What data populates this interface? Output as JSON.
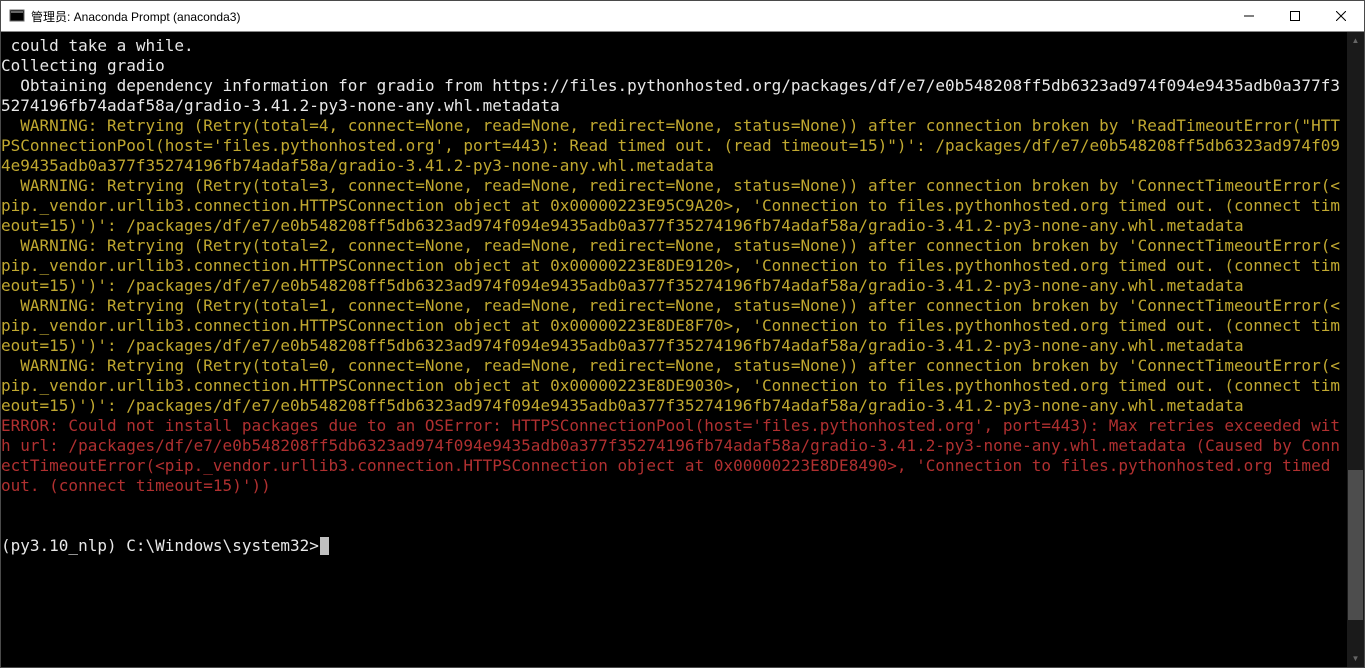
{
  "window": {
    "title": "管理员: Anaconda Prompt (anaconda3)"
  },
  "terminal": {
    "line_could_take": " could take a while.",
    "line_collecting": "Collecting gradio",
    "line_obtaining": "  Obtaining dependency information for gradio from https://files.pythonhosted.org/packages/df/e7/e0b548208ff5db6323ad974f094e9435adb0a377f35274196fb74adaf58a/gradio-3.41.2-py3-none-any.whl.metadata",
    "warning4": "  WARNING: Retrying (Retry(total=4, connect=None, read=None, redirect=None, status=None)) after connection broken by 'ReadTimeoutError(\"HTTPSConnectionPool(host='files.pythonhosted.org', port=443): Read timed out. (read timeout=15)\")': /packages/df/e7/e0b548208ff5db6323ad974f094e9435adb0a377f35274196fb74adaf58a/gradio-3.41.2-py3-none-any.whl.metadata",
    "warning3": "  WARNING: Retrying (Retry(total=3, connect=None, read=None, redirect=None, status=None)) after connection broken by 'ConnectTimeoutError(<pip._vendor.urllib3.connection.HTTPSConnection object at 0x00000223E95C9A20>, 'Connection to files.pythonhosted.org timed out. (connect timeout=15)')': /packages/df/e7/e0b548208ff5db6323ad974f094e9435adb0a377f35274196fb74adaf58a/gradio-3.41.2-py3-none-any.whl.metadata",
    "warning2": "  WARNING: Retrying (Retry(total=2, connect=None, read=None, redirect=None, status=None)) after connection broken by 'ConnectTimeoutError(<pip._vendor.urllib3.connection.HTTPSConnection object at 0x00000223E8DE9120>, 'Connection to files.pythonhosted.org timed out. (connect timeout=15)')': /packages/df/e7/e0b548208ff5db6323ad974f094e9435adb0a377f35274196fb74adaf58a/gradio-3.41.2-py3-none-any.whl.metadata",
    "warning1": "  WARNING: Retrying (Retry(total=1, connect=None, read=None, redirect=None, status=None)) after connection broken by 'ConnectTimeoutError(<pip._vendor.urllib3.connection.HTTPSConnection object at 0x00000223E8DE8F70>, 'Connection to files.pythonhosted.org timed out. (connect timeout=15)')': /packages/df/e7/e0b548208ff5db6323ad974f094e9435adb0a377f35274196fb74adaf58a/gradio-3.41.2-py3-none-any.whl.metadata",
    "warning0": "  WARNING: Retrying (Retry(total=0, connect=None, read=None, redirect=None, status=None)) after connection broken by 'ConnectTimeoutError(<pip._vendor.urllib3.connection.HTTPSConnection object at 0x00000223E8DE9030>, 'Connection to files.pythonhosted.org timed out. (connect timeout=15)')': /packages/df/e7/e0b548208ff5db6323ad974f094e9435adb0a377f35274196fb74adaf58a/gradio-3.41.2-py3-none-any.whl.metadata",
    "error": "ERROR: Could not install packages due to an OSError: HTTPSConnectionPool(host='files.pythonhosted.org', port=443): Max retries exceeded with url: /packages/df/e7/e0b548208ff5db6323ad974f094e9435adb0a377f35274196fb74adaf58a/gradio-3.41.2-py3-none-any.whl.metadata (Caused by ConnectTimeoutError(<pip._vendor.urllib3.connection.HTTPSConnection object at 0x00000223E8DE8490>, 'Connection to files.pythonhosted.org timed out. (connect timeout=15)'))",
    "blank": "",
    "prompt": "(py3.10_nlp) C:\\Windows\\system32>"
  }
}
